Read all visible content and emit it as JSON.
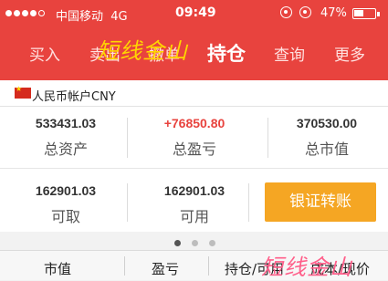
{
  "status_bar": {
    "carrier": "中国移动",
    "network": "4G",
    "time": "09:49",
    "battery": "47%",
    "battery_level": 0.47
  },
  "tabs": [
    {
      "label": "买入"
    },
    {
      "label": "卖出"
    },
    {
      "label": "撤单"
    },
    {
      "label": "持仓",
      "active": true
    },
    {
      "label": "查询"
    },
    {
      "label": "更多"
    }
  ],
  "watermark": "短线金山",
  "account": {
    "label": "人民币帐户CNY"
  },
  "summary": {
    "total_assets": {
      "value": "533431.03",
      "label": "总资产"
    },
    "total_pnl": {
      "value": "+76850.80",
      "label": "总盈亏"
    },
    "market_value": {
      "value": "370530.00",
      "label": "总市值"
    },
    "withdrawable": {
      "value": "162901.03",
      "label": "可取"
    },
    "available": {
      "value": "162901.03",
      "label": "可用"
    }
  },
  "transfer_button": "银证转账",
  "pager": {
    "total": 3,
    "current": 1
  },
  "columns": [
    "市值",
    "盈亏",
    "持仓/可用",
    "成本/现价"
  ],
  "colors": {
    "brand": "#e8433e",
    "accent_button": "#f5a623",
    "positive": "#e8433e"
  }
}
